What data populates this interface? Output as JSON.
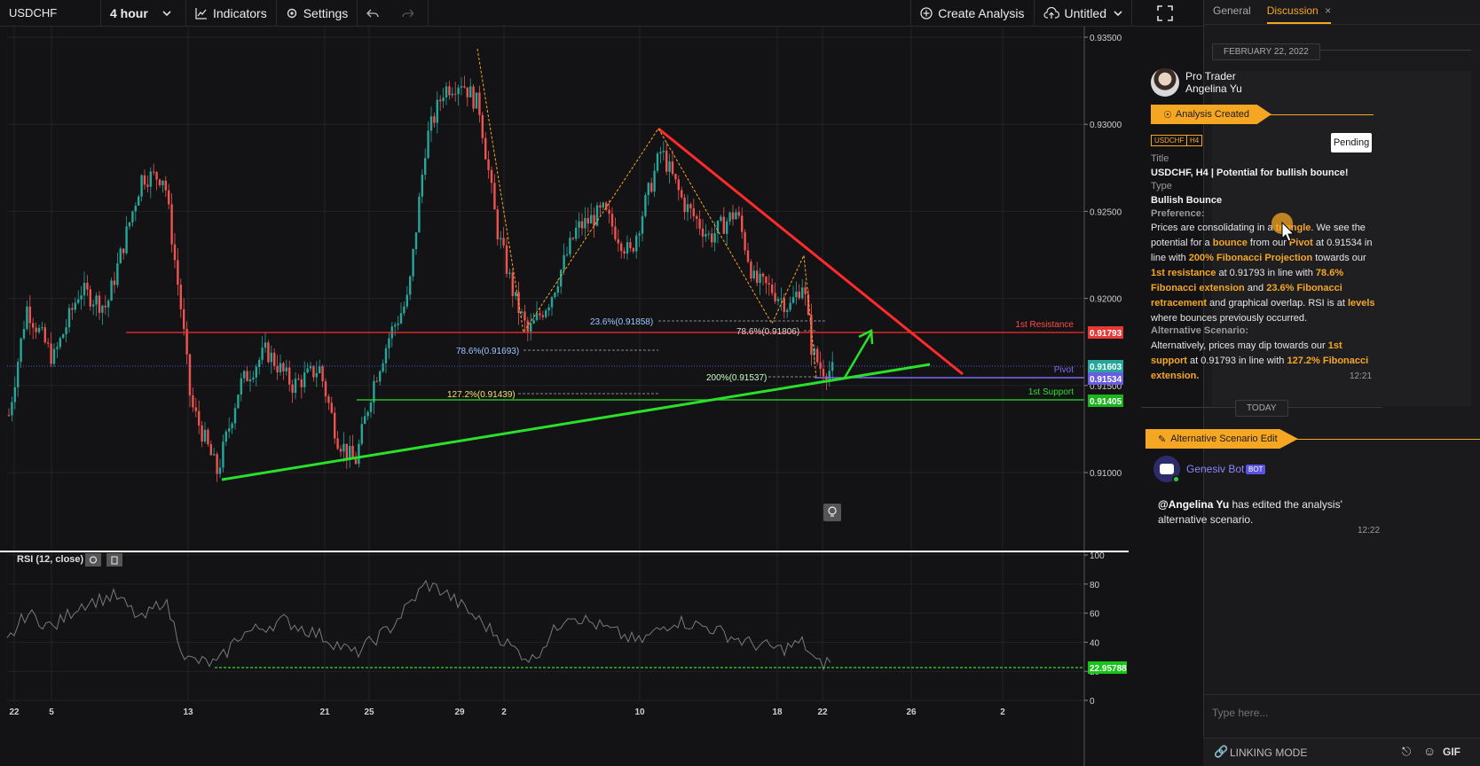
{
  "toolbar": {
    "symbol": "USDCHF",
    "timeframe": "4 hour",
    "indicators_label": "Indicators",
    "settings_label": "Settings",
    "create_analysis_label": "Create Analysis",
    "layout_name": "Untitled"
  },
  "chart": {
    "price_ticks": [
      "0.93500",
      "0.93000",
      "0.92500",
      "0.92000",
      "0.91500",
      "0.91000"
    ],
    "price_tick_values": [
      0.935,
      0.93,
      0.925,
      0.92,
      0.915,
      0.91
    ],
    "x_ticks": [
      "22",
      "5",
      "13",
      "21",
      "25",
      "29",
      "2",
      "10",
      "18",
      "22",
      "26",
      "2"
    ],
    "level_labels": {
      "resistance": "1st Resistance",
      "pivot": "Pivot",
      "support": "1st Support"
    },
    "price_badges": {
      "resistance": "0.91793",
      "current": "0.91603",
      "pivot": "0.91534",
      "support": "0.91405"
    },
    "fib_labels": {
      "f1": "23.6%(0.91858)",
      "f2": "78.6%(0.91806)",
      "f3": "78.6%(0.91693)",
      "f4": "200%(0.91537)",
      "f5": "127.2%(0.91439)"
    },
    "colors": {
      "up": "#26a69a",
      "down": "#ef5350",
      "resistance": "#ff2a2a",
      "support": "#2ae02a",
      "pivot": "#7b6cf0",
      "fib": "#f5a623"
    }
  },
  "rsi": {
    "label": "RSI (12, close)",
    "ticks": [
      "100",
      "80",
      "60",
      "40",
      "20",
      "0"
    ],
    "tick_values": [
      100,
      80,
      60,
      40,
      20,
      0
    ],
    "value_badge": "22.95788",
    "level": 22.95788
  },
  "panel": {
    "tabs": [
      "General",
      "Discussion"
    ],
    "active_tab": "Discussion",
    "date_pill": "FEBRUARY 22, 2022",
    "author_role": "Pro Trader",
    "author_name": "Angelina Yu",
    "event_banner": "Analysis Created",
    "tags": [
      "USDCHF",
      "H4"
    ],
    "status": "Pending",
    "title_label": "Title",
    "title_value": "USDCHF, H4 | Potential for bullish bounce!",
    "type_label": "Type",
    "type_value": "Bullish Bounce",
    "preference_label": "Preference:",
    "alt_label": "Alternative Scenario:",
    "card_time": "12:21",
    "today_pill": "TODAY",
    "edit_banner": "Alternative Scenario Edit",
    "bot_name": "Genesiv Bot",
    "bot_badge": "BOT",
    "bot_mention": "@Angelina Yu",
    "bot_text": " has edited the analysis' alternative scenario.",
    "bot_time": "12:22",
    "composer_placeholder": "Type here...",
    "linking_mode": "LINKING MODE",
    "gif_label": "GIF"
  }
}
